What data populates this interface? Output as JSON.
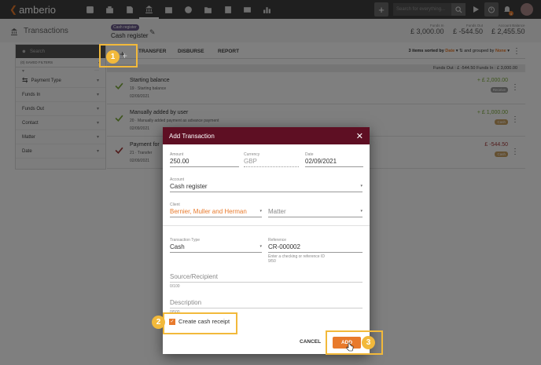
{
  "app": {
    "name": "amberio"
  },
  "topbar": {
    "nav_icons": [
      "contacts-icon",
      "matters-icon",
      "documents-icon",
      "accounting-icon",
      "calendar-icon",
      "history-icon",
      "folder-icon",
      "files-icon",
      "mail-icon",
      "reports-icon"
    ],
    "active_icon": "accounting-icon",
    "search_placeholder": "Search for everything...",
    "notification_count": "4"
  },
  "page": {
    "title": "Transactions",
    "register_badge": "Cash register",
    "register_name": "Cash register",
    "funds_in_label": "Funds In",
    "funds_in": "£ 3,000.00",
    "funds_out_label": "Funds Out",
    "funds_out": "£ -544.50",
    "balance_label": "Account Balance",
    "balance": "£ 2,455.50"
  },
  "sidebar": {
    "search_placeholder": "Search",
    "saved_filters": "(0) SAVED FILTERS",
    "filters": [
      "Payment Type",
      "Funds In",
      "Funds Out",
      "Contact",
      "Matter",
      "Date"
    ]
  },
  "toolbar": {
    "tabs": [
      "TRANSFER",
      "DISBURSE",
      "REPORT"
    ],
    "items_count": "3 items sorted by",
    "sort_field": "Date",
    "group_text": "and grouped by",
    "group_field": "None"
  },
  "funds_summary": "Funds Out : £ -544.50     Funds In : £ 3,000.00",
  "transactions": [
    {
      "title": "Starting balance",
      "meta": "19  ·  Starting balance",
      "date": "02/09/2021",
      "amount": "+ £ 2,000.00",
      "badge": "Receive",
      "amount_color": "#7cab3a",
      "badge_color": "#9a9a9a"
    },
    {
      "title": "Manually added by user",
      "meta": "20  ·  Manually added payment as advance payment",
      "date": "02/09/2021",
      "amount": "+ £ 1,000.00",
      "badge": "Cash",
      "amount_color": "#7cab3a",
      "badge_color": "#c9a063"
    },
    {
      "title": "Payment for",
      "meta": "21  ·  Transfer",
      "date": "02/09/2021",
      "amount": "£ -544.50",
      "badge": "Cash",
      "amount_color": "#a33a3a",
      "badge_color": "#c9a063"
    }
  ],
  "dialog": {
    "title": "Add Transaction",
    "amount_label": "Amount",
    "amount": "250.00",
    "currency_label": "Currency",
    "currency": "GBP",
    "date_label": "Date",
    "date": "02/09/2021",
    "account_label": "Account",
    "account": "Cash register",
    "client_label": "Client",
    "client": "Bernier, Muller and Herman",
    "matter_placeholder": "Matter",
    "type_label": "Transaction Type",
    "type": "Cash",
    "reference_label": "Reference",
    "reference": "CR-000002",
    "reference_hint": "Enter a checking or reference ID",
    "reference_count": "9/50",
    "source_placeholder": "Source/Recipient",
    "source_count": "0/100",
    "description_placeholder": "Description",
    "description_count": "0/500",
    "cash_receipt_label": "Create cash receipt",
    "cancel_label": "CANCEL",
    "add_label": "ADD"
  },
  "steps": [
    "1",
    "2",
    "3"
  ],
  "colors": {
    "accent": "#e87a2c",
    "dialog_header": "#5e0f23",
    "highlight": "#f2b93b",
    "topbar": "#3f3f3f"
  }
}
